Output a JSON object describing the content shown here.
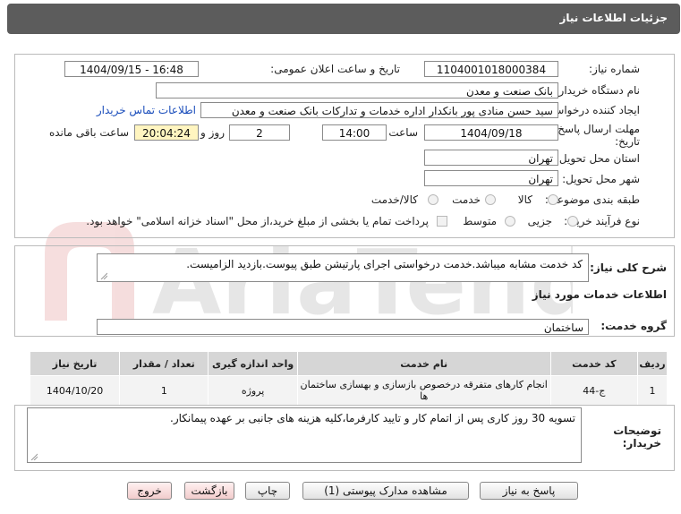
{
  "header": {
    "title": "جزئیات اطلاعات نیاز"
  },
  "form": {
    "need_number_label": "شماره نیاز:",
    "need_number": "1104001018000384",
    "announce_label": "تاریخ و ساعت اعلان عمومی:",
    "announce_value": "1404/09/15 - 16:48",
    "buyer_org_label": "نام دستگاه خریدار:",
    "buyer_org": "بانک صنعت و معدن",
    "requester_label": "ایجاد کننده درخواست:",
    "requester": "سید حسن منادی پور بانکدار اداره خدمات و تدارکات بانک صنعت و معدن",
    "contact_link": "اطلاعات تماس خریدار",
    "deadline_label_1": "مهلت ارسال پاسخ: تا",
    "deadline_label_2": "تاریخ:",
    "deadline_date": "1404/09/18",
    "time_label": "ساعت",
    "deadline_time": "14:00",
    "days_value": "2",
    "days_label": "روز و",
    "remaining_time": "20:04:24",
    "remaining_label": "ساعت باقی مانده",
    "province_label": "استان محل تحویل:",
    "province": "تهران",
    "city_label": "شهر محل تحویل:",
    "city": "تهران",
    "category_label": "طبقه بندی موضوعی:",
    "category_options": [
      "کالا",
      "خدمت",
      "کالا/خدمت"
    ],
    "process_label": "نوع فرآیند خرید :",
    "process_options": [
      "جزیی",
      "متوسط"
    ],
    "payment_note": "پرداخت تمام یا بخشی از مبلغ خرید،از محل \"اسناد خزانه اسلامی\" خواهد بود."
  },
  "description": {
    "label": "شرح کلی نیاز:",
    "text": "کد خدمت مشابه میباشد.خدمت درخواستی اجرای پارتیشن طبق پیوست.بازدید الزامیست."
  },
  "services": {
    "section_title": "اطلاعات خدمات مورد نیاز",
    "group_label": "گروه خدمت:",
    "group_value": "ساختمان",
    "columns": [
      "ردیف",
      "کد خدمت",
      "نام خدمت",
      "واحد اندازه گیری",
      "تعداد / مقدار",
      "تاریخ نیاز"
    ],
    "rows": [
      [
        "1",
        "ج-44",
        "انجام کارهای متفرقه درخصوص بازسازی و بهسازی ساختمان ها",
        "پروژه",
        "1",
        "1404/10/20"
      ]
    ]
  },
  "buyer_notes": {
    "label_1": "توضیحات",
    "label_2": "خریدار:",
    "text": "تسویه 30 روز کاری پس از اتمام کار و تایید کارفرما،کلیه هزینه های جانبی بر عهده پیمانکار."
  },
  "buttons": {
    "reply": "پاسخ به نیاز",
    "attachments": "مشاهده مدارک پیوستی (1)",
    "print": "چاپ",
    "back": "بازگشت",
    "exit": "خروج"
  }
}
